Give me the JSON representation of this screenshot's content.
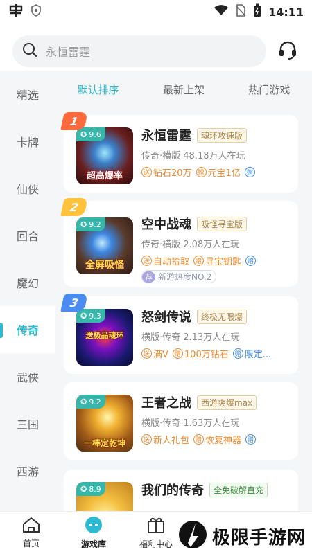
{
  "status": {
    "time": "14:11"
  },
  "search": {
    "placeholder": "永恒雷霆"
  },
  "sidebar": {
    "items": [
      {
        "label": "精选"
      },
      {
        "label": "卡牌"
      },
      {
        "label": "仙侠"
      },
      {
        "label": "回合"
      },
      {
        "label": "魔幻"
      },
      {
        "label": "传奇"
      },
      {
        "label": "武侠"
      },
      {
        "label": "三国"
      },
      {
        "label": "西游"
      }
    ],
    "active_index": 5
  },
  "sort_tabs": [
    {
      "label": "默认排序"
    },
    {
      "label": "最新上架"
    },
    {
      "label": "热门游戏"
    }
  ],
  "games": [
    {
      "rank": "1",
      "score": "9.6",
      "thumb_label": "超高爆率",
      "name": "永恒雷霆",
      "badge": "魂环攻速版",
      "meta": "传奇·横版 48.18万人在玩",
      "tags": [
        {
          "icon": "送",
          "text": "钻石20万"
        },
        {
          "icon": "赠",
          "text": "元宝1亿"
        }
      ],
      "gift": "赠"
    },
    {
      "rank": "2",
      "score": "9.2",
      "thumb_label": "全屏吸怪",
      "name": "空中战魂",
      "badge": "吸怪寻宝版",
      "meta": "传奇·横版 2.08万人在玩",
      "tags": [
        {
          "icon": "送",
          "text": "自动拾取"
        },
        {
          "icon": "赠",
          "text": "寻宝钥匙"
        }
      ],
      "gift": "赠",
      "rec_tag": "荐",
      "rec_text": "新游热度NO.2"
    },
    {
      "rank": "3",
      "score": "9.3",
      "thumb_label": "送极品魂环",
      "name": "怒剑传说",
      "badge": "终极无限爆",
      "meta": "横版·传奇 2.13万人在玩",
      "tags": [
        {
          "icon": "送",
          "text": "满V"
        },
        {
          "icon": "赠",
          "text": "100万钻石"
        }
      ],
      "gift": "赠",
      "gift_text": "限定..."
    },
    {
      "rank": "",
      "score": "9.2",
      "thumb_label": "一棒定乾坤",
      "name": "王者之战",
      "badge": "西游爽爆max",
      "meta": "横版·传奇 1.63万人在玩",
      "tags": [
        {
          "icon": "送",
          "text": "新人礼包"
        },
        {
          "icon": "赠",
          "text": "恢复神器"
        }
      ],
      "gift": "赠"
    },
    {
      "rank": "",
      "score": "8.9",
      "thumb_label": "",
      "name": "我们的传奇",
      "badge": "全免破解直充",
      "meta": "",
      "tags": []
    }
  ],
  "bottom_nav": [
    {
      "label": "首页",
      "icon": "home-icon"
    },
    {
      "label": "游戏库",
      "icon": "game-library-icon"
    },
    {
      "label": "福利中心",
      "icon": "gift-box-icon"
    }
  ],
  "watermark": {
    "text": "极限手游网"
  },
  "colors": {
    "accent": "#2bbad1",
    "rank1": "#ff6a3d",
    "rank2": "#ffc23a",
    "rank3": "#4a8cf0"
  }
}
